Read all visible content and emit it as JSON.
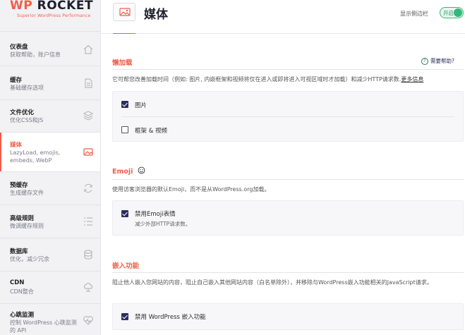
{
  "brand": {
    "logo_wp": "WP",
    "logo_rocket": "ROCKET",
    "logo_sub": "Superior WordPress Performance",
    "accent": "#f05e4a"
  },
  "sidebar": {
    "items": [
      {
        "title": "仪表盘",
        "sub": "获取帮助，账户信息",
        "icon": "home-icon"
      },
      {
        "title": "缓存",
        "sub": "基础缓存选项",
        "icon": "file-icon"
      },
      {
        "title": "文件优化",
        "sub": "优化CSS和JS",
        "icon": "layers-icon"
      },
      {
        "title": "媒体",
        "sub": "LazyLoad, emojis, embeds, WebP",
        "icon": "media-icon",
        "active": true
      },
      {
        "title": "预缓存",
        "sub": "生成缓存文件",
        "icon": "refresh-icon"
      },
      {
        "title": "高级规则",
        "sub": "微调缓存规则",
        "icon": "list-icon"
      },
      {
        "title": "数据库",
        "sub": "优化，减少冗余",
        "icon": "database-icon"
      },
      {
        "title": "CDN",
        "sub": "CDN整合",
        "icon": "cdn-icon"
      },
      {
        "title": "心跳监测",
        "sub": "控制 WordPress 心跳监测的 API",
        "icon": "heartbeat-icon"
      }
    ]
  },
  "header": {
    "title": "媒体",
    "sidebar_toggle_label": "显示侧边栏",
    "toggle_state": "开启"
  },
  "lazyload": {
    "title": "懒加载",
    "help": "需要帮助?",
    "desc": "它可帮您改善加载时间（例如: 图片, 内嵌框架和视频将仅在进入或即将进入可视区域时才加载）和减少HTTP请求数.",
    "more": "更多信息",
    "options": [
      {
        "label": "图片",
        "checked": true
      },
      {
        "label": "框架 & 视频",
        "checked": false
      }
    ]
  },
  "emoji": {
    "title": "Emoji",
    "desc": "使用访客浏览器的默认Emoji，而不是从WordPress.org加载。",
    "option": {
      "label": "禁用Emoji表情",
      "sub": "减少外部HTTP请求数。",
      "checked": true
    }
  },
  "embeds": {
    "title": "嵌入功能",
    "desc": "阻止他人嵌入您网站的内容，阻止自己嵌入其他网站内容（白名单除外），并移除与WordPress嵌入功能相关的JavaScript请求。",
    "option": {
      "label": "禁用 WordPress 嵌入功能",
      "checked": true
    }
  }
}
